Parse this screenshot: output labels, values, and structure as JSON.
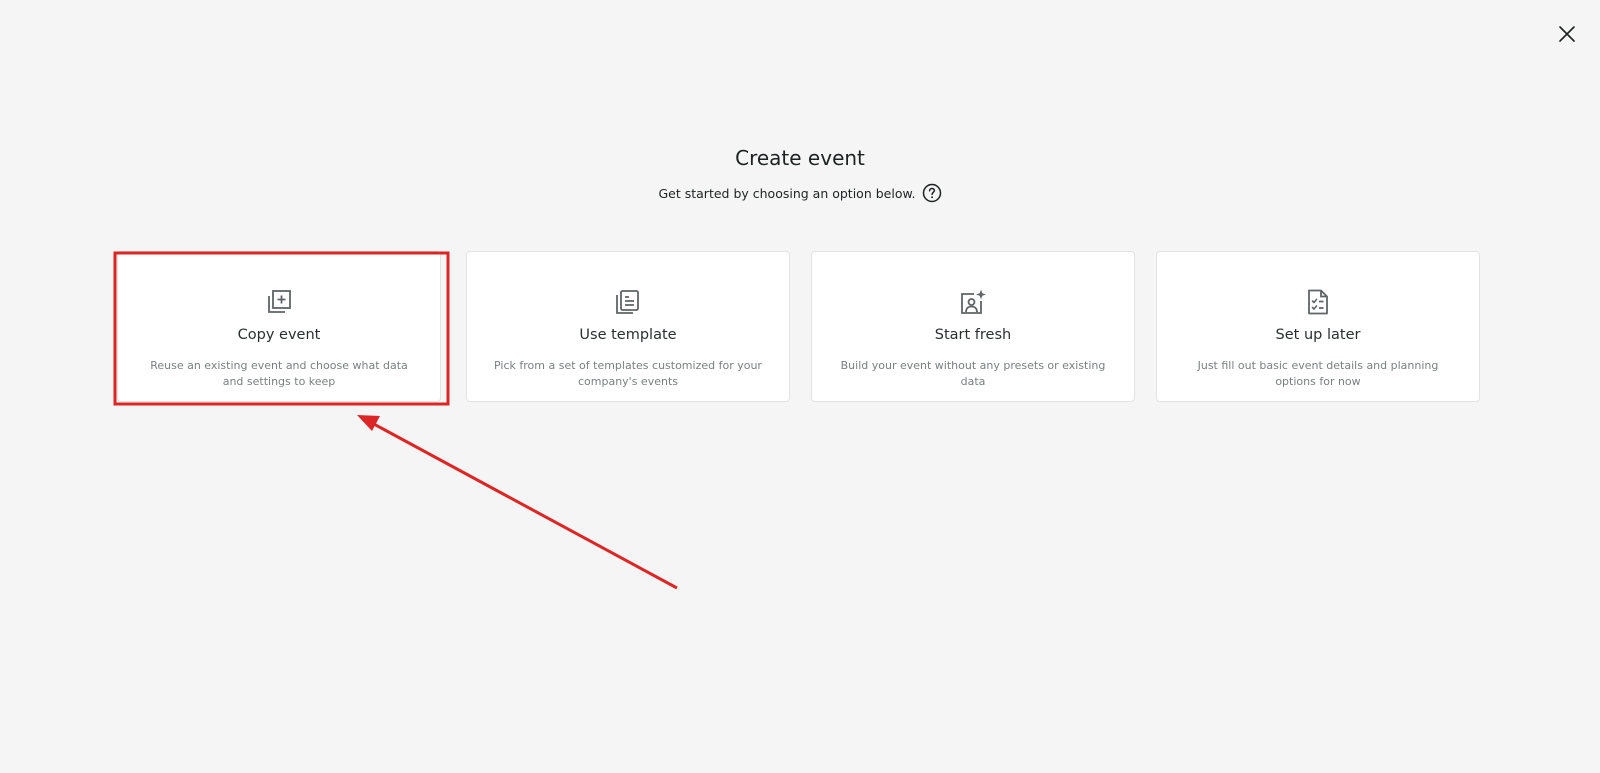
{
  "dialog": {
    "title": "Create event",
    "subtitle": "Get started by choosing an option below."
  },
  "icons": {
    "close": "close-icon",
    "help": "question-circle-icon"
  },
  "options": [
    {
      "id": "copy",
      "title": "Copy event",
      "description": "Reuse an existing event and choose what data and settings to keep",
      "icon": "copy-plus-icon"
    },
    {
      "id": "template",
      "title": "Use template",
      "description": "Pick from a set of templates customized for your company's events",
      "icon": "document-template-icon"
    },
    {
      "id": "fresh",
      "title": "Start fresh",
      "description": "Build your event without any presets or existing data",
      "icon": "user-sparkle-icon"
    },
    {
      "id": "later",
      "title": "Set up later",
      "description": "Just fill out basic event details and planning options for now",
      "icon": "checklist-document-icon"
    }
  ],
  "colors": {
    "background": "#f4f5f4",
    "card": "#ffffff",
    "icon": "#5f6566",
    "annotation": "#dc2626"
  }
}
